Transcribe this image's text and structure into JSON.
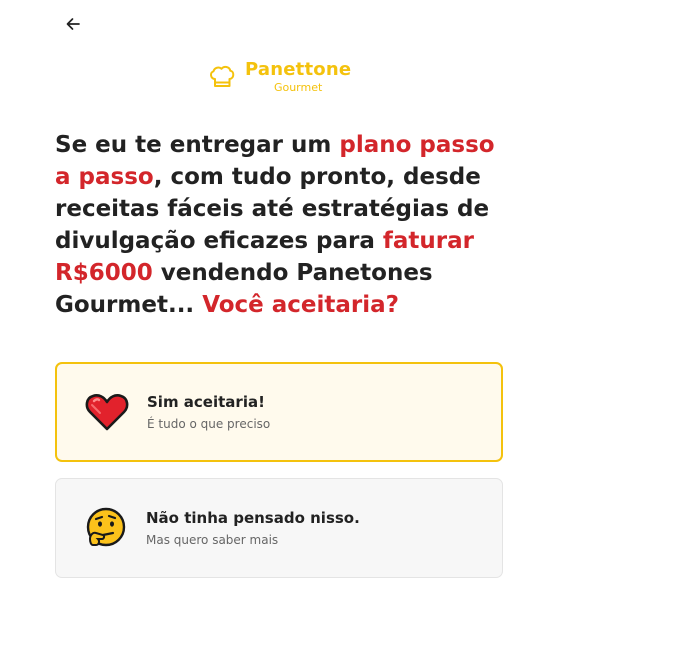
{
  "header": {
    "back_icon": "arrow-left-icon"
  },
  "logo": {
    "icon": "chef-hat-icon",
    "title": "Panettone",
    "subtitle": "Gourmet",
    "color": "#f4c20d"
  },
  "headline": {
    "part1": "Se eu te entregar um ",
    "highlight1": "plano passo a passo",
    "part2": ", com tudo pronto, desde receitas fáceis até estratégias de divulgação eficazes para ",
    "highlight2": "faturar R$6000",
    "part3": " vendendo Panetones Gourmet... ",
    "highlight3": "Você aceitaria?",
    "highlight_color": "#d3262b"
  },
  "options": [
    {
      "icon": "red-heart-icon",
      "title": "Sim aceitaria!",
      "subtitle": "É tudo o que preciso",
      "selected": true,
      "border_color": "#f4c20d"
    },
    {
      "icon": "thinking-face-icon",
      "title": "Não tinha pensado nisso.",
      "subtitle": "Mas quero saber mais",
      "selected": false
    }
  ]
}
